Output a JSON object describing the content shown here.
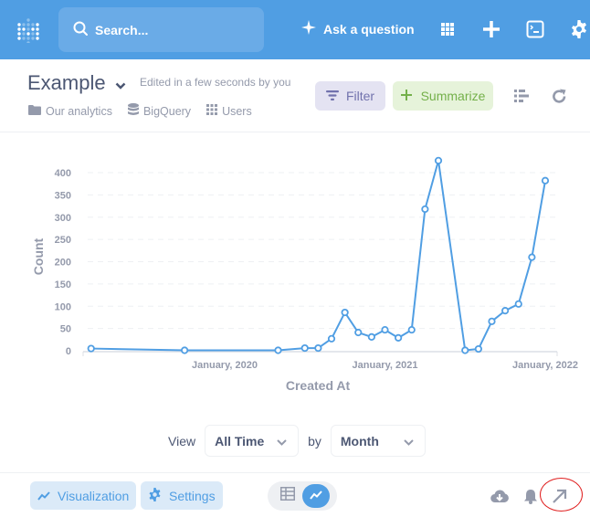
{
  "topbar": {
    "logo_icon": "metabase-logo-icon",
    "search_placeholder": "Search...",
    "ask_label": "Ask a question",
    "icons": [
      "grid-icon",
      "plus-icon",
      "terminal-icon",
      "gear-icon"
    ],
    "color": "#509ee3"
  },
  "header": {
    "title": "Example",
    "edited": "Edited in a few seconds by you",
    "breadcrumbs": [
      {
        "icon": "folder-icon",
        "label": "Our analytics"
      },
      {
        "icon": "database-icon",
        "label": "BigQuery"
      },
      {
        "icon": "table-icon",
        "label": "Users"
      }
    ],
    "filter_label": "Filter",
    "summarize_label": "Summarize"
  },
  "chart_data": {
    "type": "line",
    "xlabel": "Created At",
    "ylabel": "Count",
    "ylim": [
      0,
      400
    ],
    "yticks": [
      0,
      50,
      100,
      150,
      200,
      250,
      300,
      350,
      400
    ],
    "xticks": [
      {
        "label": "January, 2020",
        "month": 12
      },
      {
        "label": "January, 2021",
        "month": 24
      },
      {
        "label": "January, 2022",
        "month": 36
      }
    ],
    "x_range_months": [
      1.9,
      36.5
    ],
    "grid": true,
    "series": [
      {
        "name": "Count",
        "color": "#509ee3",
        "points": [
          {
            "x": "March, 2019",
            "month": 2,
            "y": 5
          },
          {
            "x": "October, 2019",
            "month": 9,
            "y": 1
          },
          {
            "x": "May, 2020",
            "month": 16,
            "y": 1
          },
          {
            "x": "July, 2020",
            "month": 18,
            "y": 6
          },
          {
            "x": "August, 2020",
            "month": 19,
            "y": 6
          },
          {
            "x": "September, 2020",
            "month": 20,
            "y": 27
          },
          {
            "x": "October, 2020",
            "month": 21,
            "y": 86
          },
          {
            "x": "November, 2020",
            "month": 22,
            "y": 41
          },
          {
            "x": "December, 2020",
            "month": 23,
            "y": 31
          },
          {
            "x": "January, 2021",
            "month": 24,
            "y": 47
          },
          {
            "x": "February, 2021",
            "month": 25,
            "y": 29
          },
          {
            "x": "March, 2021",
            "month": 26,
            "y": 47
          },
          {
            "x": "April, 2021",
            "month": 27,
            "y": 318
          },
          {
            "x": "May, 2021",
            "month": 28,
            "y": 427
          },
          {
            "x": "July, 2021",
            "month": 30,
            "y": 1
          },
          {
            "x": "August, 2021",
            "month": 31,
            "y": 4
          },
          {
            "x": "September, 2021",
            "month": 32,
            "y": 66
          },
          {
            "x": "October, 2021",
            "month": 33,
            "y": 90
          },
          {
            "x": "November, 2021",
            "month": 34,
            "y": 105
          },
          {
            "x": "December, 2021",
            "month": 35,
            "y": 210
          },
          {
            "x": "January, 2022",
            "month": 36,
            "y": 382
          }
        ]
      }
    ]
  },
  "controls": {
    "view_label": "View",
    "view_value": "All Time",
    "by_label": "by",
    "by_value": "Month"
  },
  "footer": {
    "visualization_label": "Visualization",
    "settings_label": "Settings",
    "toggle_options": [
      "table-icon",
      "line-chart-icon"
    ],
    "toggle_active": "line-chart-icon",
    "right_icons": [
      "download-icon",
      "bell-icon",
      "expand-arrow-icon"
    ]
  }
}
